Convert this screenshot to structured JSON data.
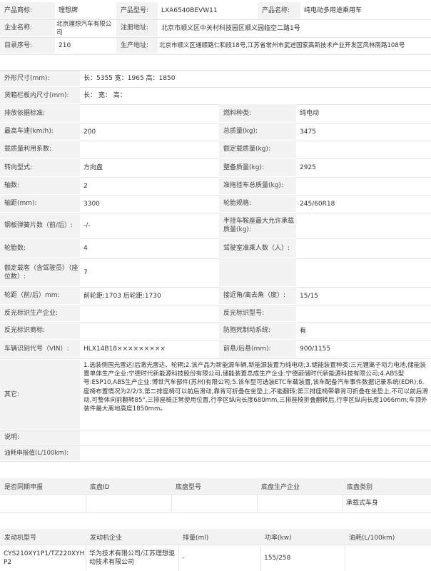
{
  "top": {
    "brand_label": "产品商标:",
    "brand_value": "理想牌",
    "model_label": "产品型号:",
    "model_value": "LXA6540BEVW11",
    "name_label": "产品名称:",
    "name_value": "纯电动多用途乘用车",
    "company_label": "企业名称:",
    "company_value": "北京理想汽车有限公司",
    "reg_addr_label": "注册地址:",
    "reg_addr_value": "北京市顺义区中关村科技园区顺义园临空二路1号",
    "catalog_label": "目录序号:",
    "catalog_value": "210",
    "prod_addr_label": "生产地址:",
    "prod_addr_value": "北京市顺义区通顺路仁和段18号,江苏省常州市武进国家高新技术产业开发区凤林南路108号"
  },
  "specs": [
    {
      "l1": "外形尺寸(mm):",
      "v1": "长：5355 宽：1965 高：1850",
      "l2": "",
      "v2": ""
    },
    {
      "l1": "货箱栏板内尺寸(mm):",
      "v1": "长： 宽： 高：",
      "l2": "",
      "v2": ""
    },
    {
      "l1": "排放依据标准:",
      "v1": "",
      "l2": "燃料种类:",
      "v2": "纯电动"
    },
    {
      "l1": "最高车速(km/h):",
      "v1": "200",
      "l2": "总质量(kg):",
      "v2": "3475"
    },
    {
      "l1": "载质量利用系数:",
      "v1": "",
      "l2": "额定载质量(kg):",
      "v2": ""
    },
    {
      "l1": "转向型式:",
      "v1": "方向盘",
      "l2": "整备质量(kg):",
      "v2": "2925"
    },
    {
      "l1": "轴数:",
      "v1": "2",
      "l2": "准拖挂车总质量(kg):",
      "v2": ""
    },
    {
      "l1": "轴距(mm):",
      "v1": "3300",
      "l2": "轮胎规格:",
      "v2": "245/60R18"
    },
    {
      "l1": "钢板弹簧片数（前/后）:",
      "v1": "-/-",
      "l2": "半挂车鞍座最大允许承载质量(kg):",
      "v2": ""
    },
    {
      "l1": "轮胎数:",
      "v1": "4",
      "l2": "驾驶室准乘人数（人）:",
      "v2": ""
    },
    {
      "l1": "额定载客（含驾驶员）（座位数）:",
      "v1": "7",
      "l2": "",
      "v2": ""
    },
    {
      "l1": "轮距（前/后）mm:",
      "v1": "前轮距:1703 后轮距:1730",
      "l2": "接近角/离去角（度）:",
      "v2": "15/15"
    },
    {
      "l1": "反光标识生产企业:",
      "v1": "",
      "l2": "反光标识型号:",
      "v2": ""
    },
    {
      "l1": "反光标识商标:",
      "v1": "",
      "l2": "防抱死制动系统:",
      "v2": "有"
    },
    {
      "l1": "车辆识别代号（VIN）:",
      "v1": "HLX14B18×××××××××",
      "l2": "前悬/后悬(mm):",
      "v2": "900/1155"
    }
  ],
  "other": {
    "label": "其它:",
    "text": "1.选装侧围光雷达/后激光雷达、轮辋;2.该产品为新能源车辆,新能源装置为纯电动;3.储能装置种类:三元锂离子动力电池,储能装置单体生产企业:宁德时代新能源科技股份有限公司,储能装置总成生产企业:宁德蔚储时代新能源科技有限公司;4.ABS型号:ESP10,ABS生产企业:博世汽车部件(苏州)有限公司;5.该车型可选装ETC车载装置,该车配备汽车事件数据记录系统(EDR);6.座椅布置情况为2/2/3,第二排座椅可以前后滑动,靠背可折叠在坐垫上,不能翻转;第三排座椅带靠背可折叠在坐垫上,不可以前后滑动,可整体向前翻转85°,三排座椅正常使用位置,行李区纵向长度680mm,三排座椅折叠翻转后,行李区纵向长度1066mm;车顶外装件最大离地高度1850mm。"
  },
  "note_label": "说明:",
  "fuel_label": "油耗申报值(L/100km):",
  "chassis": {
    "headers": [
      "是否同期申报",
      "底盘ID",
      "底盘型号",
      "底盘生产企业",
      "底盘类别"
    ],
    "row": [
      "",
      "",
      "",
      "",
      "承载式车身"
    ]
  },
  "engine": {
    "headers": [
      "发动机型号",
      "发动机企业",
      "排量(ml)",
      "功率(kw)",
      "油耗(L/100km)"
    ],
    "row": [
      "CYS210XY1P1/TZ220XYHP2",
      "华为技术有限公司/江苏理想驱动技术有限公司",
      "-",
      "155/258",
      ""
    ]
  }
}
